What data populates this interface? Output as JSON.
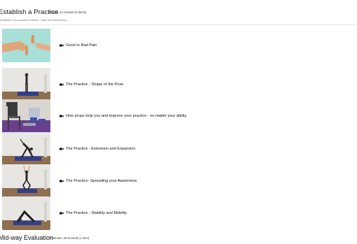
{
  "section": {
    "title": "Establish a Practice",
    "meta": "2 hours, 12 minutes (6 items)",
    "subtitle": "Establish a Successful Practice, Gain Self Awareness"
  },
  "lessons": [
    {
      "title": "Good or Bad Pain",
      "thumb_icon": "thumbs-up-down-image"
    },
    {
      "title": "The Practice - Shape of the Pose",
      "thumb_icon": "standing-pose-image"
    },
    {
      "title": "How props help you and improve your practice - no matter your ability.",
      "thumb_icon": "props-chair-image"
    },
    {
      "title": "The Practice - Extension and Expansion",
      "thumb_icon": "triangle-pose-image"
    },
    {
      "title": "The Practice- Spreading your Awareness",
      "thumb_icon": "arms-raised-pose-image"
    },
    {
      "title": "The Practice - Stability and Mobility",
      "thumb_icon": "down-dog-pose-image"
    }
  ],
  "next_section": {
    "title": "Mid-way Evaluation",
    "meta": "4 minutes, 26 seconds (1 item)"
  },
  "colors": {
    "wall": "#e8e6e3",
    "floor": "#a0825f",
    "mat": "#2f3f8f",
    "teal": "#a8e0d8",
    "accent": "#111111"
  }
}
